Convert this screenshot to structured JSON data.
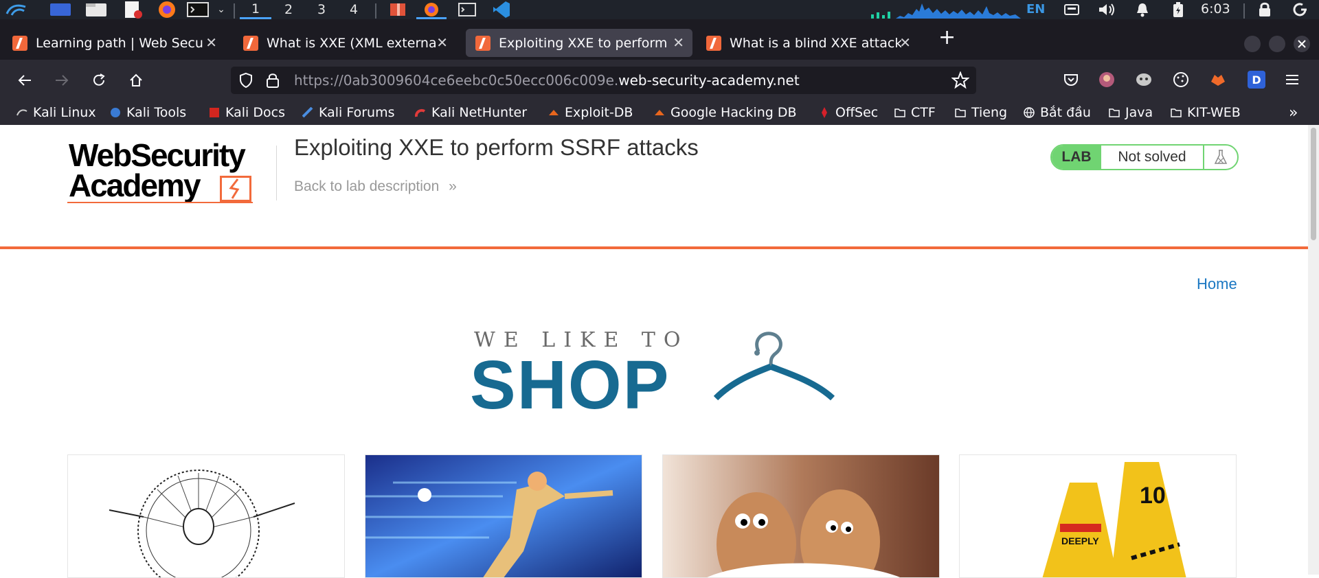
{
  "system_panel": {
    "workspaces": [
      "1",
      "2",
      "3",
      "4"
    ],
    "active_workspace": "1",
    "language": "EN",
    "clock": "6:03"
  },
  "tabs": [
    {
      "title": "Learning path | Web Secu",
      "active": false
    },
    {
      "title": "What is XXE (XML externa",
      "active": false
    },
    {
      "title": "Exploiting XXE to perform",
      "active": true
    },
    {
      "title": "What is a blind XXE attack",
      "active": false
    }
  ],
  "url": {
    "prefix": "https://0ab3009604ce6eebc0c50ecc006c009e.",
    "host": "web-security-academy.net"
  },
  "bookmarks": [
    "Kali Linux",
    "Kali Tools",
    "Kali Docs",
    "Kali Forums",
    "Kali NetHunter",
    "Exploit-DB",
    "Google Hacking DB",
    "OffSec",
    "CTF",
    "Tieng",
    "Bắt đầu",
    "Java",
    "KIT-WEB"
  ],
  "page": {
    "logo_line1": "WebSecurity",
    "logo_line2": "Academy",
    "lab_title": "Exploiting XXE to perform SSRF attacks",
    "back_link": "Back to lab description",
    "lab_badge": "LAB",
    "lab_status": "Not solved",
    "home_link": "Home",
    "banner_top": "WE LIKE TO",
    "banner_main": "SHOP"
  },
  "colors": {
    "accent_orange": "#f26a3b",
    "lab_green": "#70d472",
    "shop_blue": "#176a91",
    "link_blue": "#1a77c2"
  }
}
